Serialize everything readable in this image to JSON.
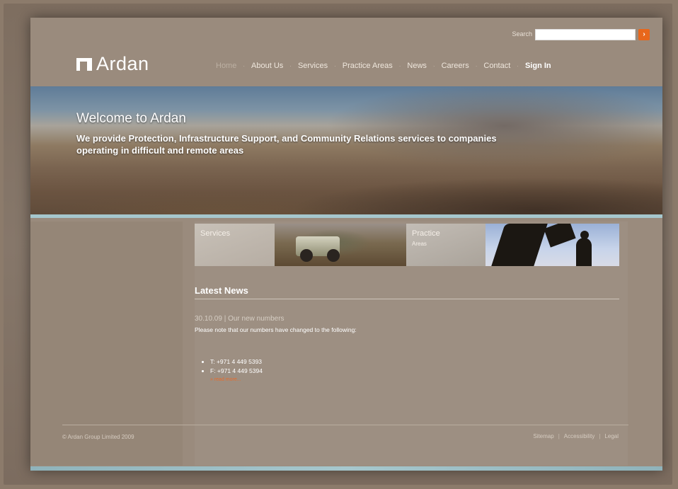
{
  "search": {
    "label": "Search",
    "value": "",
    "button_glyph": "›",
    "button_icon": "arrow-right-icon",
    "button_color": "#e8671b"
  },
  "logo": {
    "text": "Ardan"
  },
  "nav": {
    "items": [
      {
        "label": "Home"
      },
      {
        "label": "About Us"
      },
      {
        "label": "Services"
      },
      {
        "label": "Practice Areas"
      },
      {
        "label": "News"
      },
      {
        "label": "Careers"
      },
      {
        "label": "Contact"
      }
    ],
    "sign_in": "Sign In"
  },
  "hero": {
    "title": "Welcome to Ardan",
    "subtitle": "We provide Protection, Infrastructure Support, and Community Relations services to companies operating in difficult and remote areas"
  },
  "promos": [
    {
      "label": "Services",
      "sub": ""
    },
    {
      "label": "Practice",
      "sub": "Areas"
    }
  ],
  "news": {
    "heading": "Latest News",
    "date_title": "30.10.09 | Our new numbers",
    "body": "Please note that our numbers have changed to the following:",
    "items": [
      "T: +971 4 449 5393",
      "F: +971 4 449 5394"
    ],
    "more": "» read more..."
  },
  "footer": {
    "copyright": "© Ardan Group Limited 2009",
    "links": [
      "Sitemap",
      "Accessibility",
      "Legal"
    ]
  },
  "colors": {
    "accent": "#e8671b",
    "strip": "#a6c7cd"
  }
}
